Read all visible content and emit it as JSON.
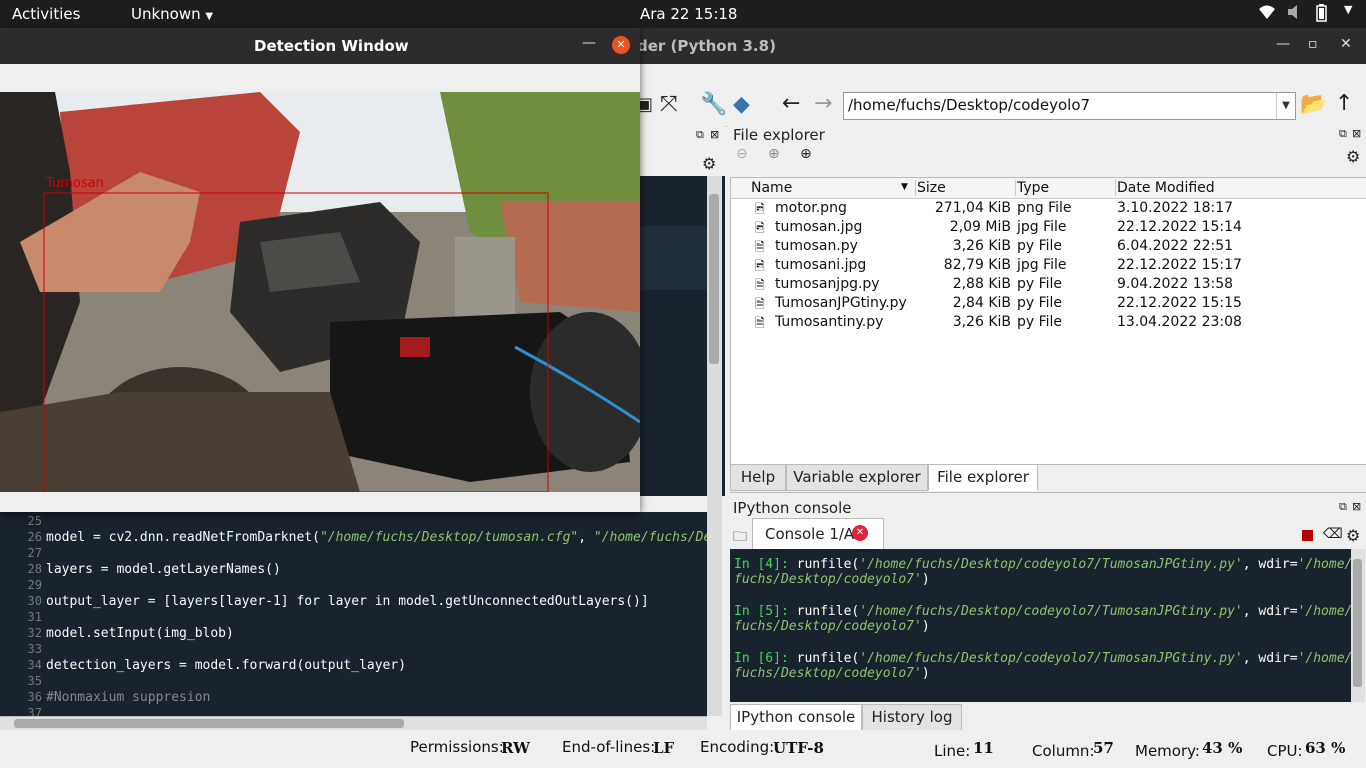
{
  "topbar": {
    "activities": "Activities",
    "app_menu": "Unknown",
    "clock": "Ara 22  15:18"
  },
  "spyder": {
    "title_fragment": "der (Python 3.8)"
  },
  "toolbar": {
    "path": "/home/fuchs/Desktop/codeyolo7"
  },
  "detection_window": {
    "title": "Detection Window",
    "label": "Tumosan",
    "box_color": "#cc0000"
  },
  "editor": {
    "lines": [
      {
        "n": "25",
        "code": ""
      },
      {
        "n": "26",
        "code": "model = cv2.dnn.readNetFromDarknet(",
        "s1": "\"/home/fuchs/Desktop/tumosan.cfg\"",
        "mid": ", ",
        "s2": "\"/home/fuchs/Deskt"
      },
      {
        "n": "27",
        "code": ""
      },
      {
        "n": "28",
        "code": "layers = model.getLayerNames()"
      },
      {
        "n": "29",
        "code": ""
      },
      {
        "n": "30",
        "code": "output_layer = [layers[layer-1] for layer in model.getUnconnectedOutLayers()]"
      },
      {
        "n": "31",
        "code": ""
      },
      {
        "n": "32",
        "code": "model.setInput(img_blob)"
      },
      {
        "n": "33",
        "code": ""
      },
      {
        "n": "34",
        "code": "detection_layers = model.forward(output_layer)"
      },
      {
        "n": "35",
        "code": ""
      },
      {
        "n": "36",
        "code": "#Nonmaxium suppresion"
      },
      {
        "n": "37",
        "code": ""
      }
    ]
  },
  "file_explorer": {
    "title": "File explorer",
    "headers": {
      "name": "Name",
      "size": "Size",
      "type": "Type",
      "date": "Date Modified"
    },
    "files": [
      {
        "name": "motor.png",
        "size": "271,04 KiB",
        "type": "png File",
        "date": "3.10.2022 18:17",
        "icon": "image-icon"
      },
      {
        "name": "tumosan.jpg",
        "size": "2,09 MiB",
        "type": "jpg File",
        "date": "22.12.2022 15:14",
        "icon": "image-icon"
      },
      {
        "name": "tumosan.py",
        "size": "3,26 KiB",
        "type": "py File",
        "date": "6.04.2022 22:51",
        "icon": "file-icon"
      },
      {
        "name": "tumosani.jpg",
        "size": "82,79 KiB",
        "type": "jpg File",
        "date": "22.12.2022 15:17",
        "icon": "image-icon"
      },
      {
        "name": "tumosanjpg.py",
        "size": "2,88 KiB",
        "type": "py File",
        "date": "9.04.2022 13:58",
        "icon": "file-icon"
      },
      {
        "name": "TumosanJPGtiny.py",
        "size": "2,84 KiB",
        "type": "py File",
        "date": "22.12.2022 15:15",
        "icon": "file-icon"
      },
      {
        "name": "Tumosantiny.py",
        "size": "3,26 KiB",
        "type": "py File",
        "date": "13.04.2022 23:08",
        "icon": "file-icon"
      }
    ],
    "tabs": [
      "Help",
      "Variable explorer",
      "File explorer"
    ]
  },
  "console": {
    "title": "IPython console",
    "tab": "Console 1/A",
    "entries": [
      {
        "prompt": "In [4]:",
        "cmd": " runfile(",
        "arg": "'/home/fuchs/Desktop/codeyolo7/TumosanJPGtiny.py'",
        "mid": ", wdir=",
        "wd1": "'/home/",
        "wd2": "fuchs/Desktop/codeyolo7'",
        "end": ")"
      },
      {
        "prompt": "In [5]:",
        "cmd": " runfile(",
        "arg": "'/home/fuchs/Desktop/codeyolo7/TumosanJPGtiny.py'",
        "mid": ", wdir=",
        "wd1": "'/home/",
        "wd2": "fuchs/Desktop/codeyolo7'",
        "end": ")"
      },
      {
        "prompt": "In [6]:",
        "cmd": " runfile(",
        "arg": "'/home/fuchs/Desktop/codeyolo7/TumosanJPGtiny.py'",
        "mid": ", wdir=",
        "wd1": "'/home/",
        "wd2": "fuchs/Desktop/codeyolo7'",
        "end": ")"
      }
    ],
    "tabs": [
      "IPython console",
      "History log"
    ]
  },
  "status": {
    "permissions_label": "Permissions:",
    "permissions": "RW",
    "eol_label": "End-of-lines:",
    "eol": "LF",
    "encoding_label": "Encoding:",
    "encoding": "UTF-8",
    "line_label": "Line:",
    "line": "11",
    "column_label": "Column:",
    "column": "57",
    "memory_label": "Memory:",
    "memory": "43 %",
    "cpu_label": "CPU:",
    "cpu": "63 %"
  }
}
